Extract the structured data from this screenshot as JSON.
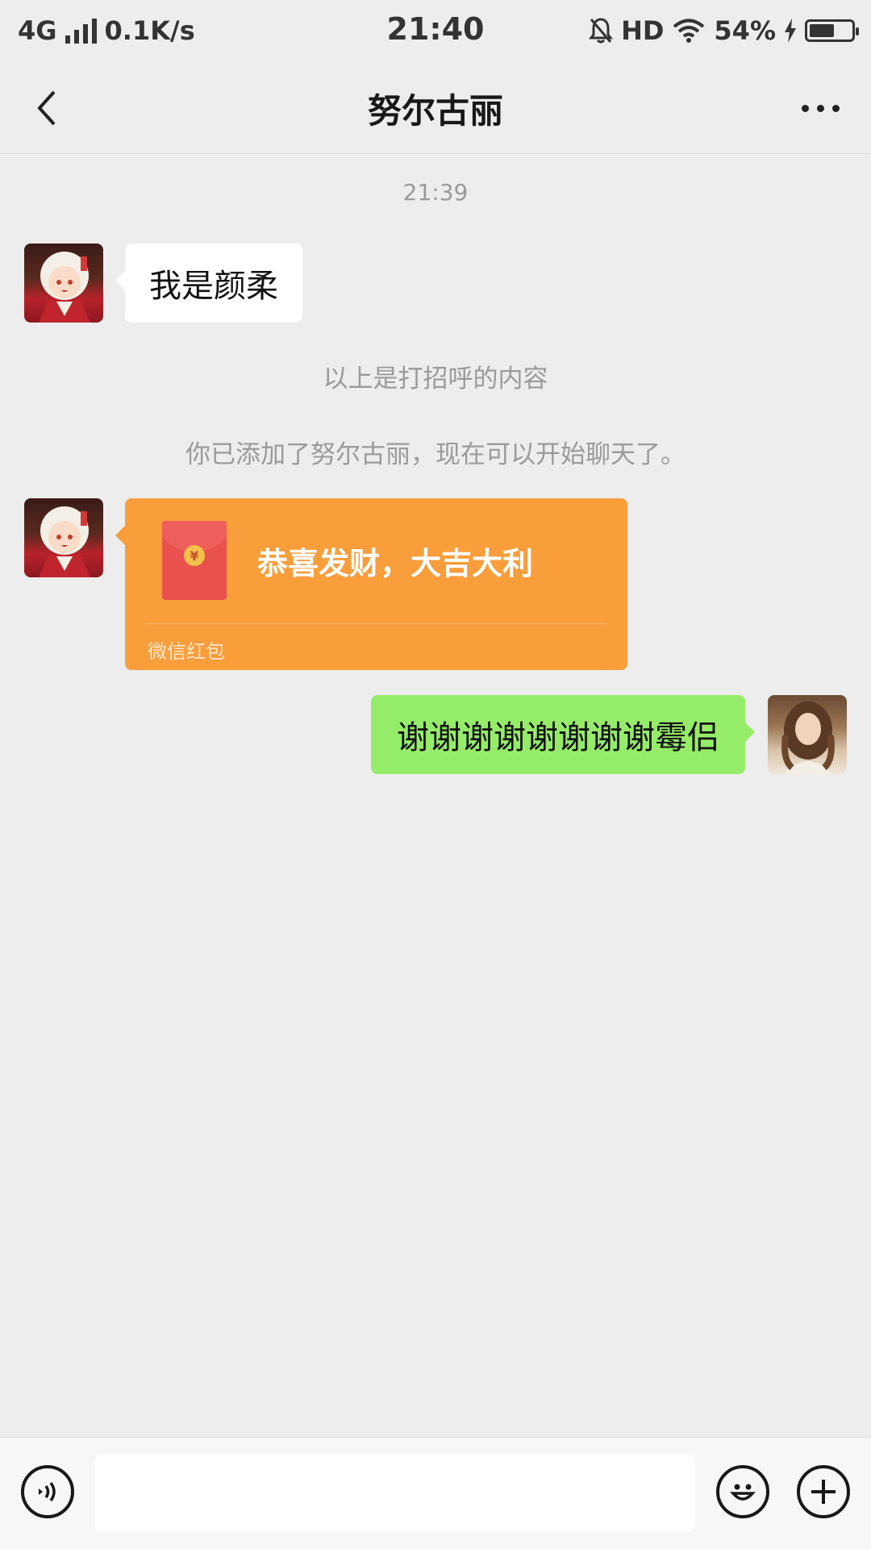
{
  "status_bar": {
    "network": "4G",
    "speed": "0.1K/s",
    "time": "21:40",
    "hd": "HD",
    "battery": "54%"
  },
  "nav": {
    "title": "努尔古丽"
  },
  "chat": {
    "timestamp": "21:39",
    "msg_greeting": "我是颜柔",
    "notice_greeting": "以上是打招呼的内容",
    "notice_added": "你已添加了努尔古丽，现在可以开始聊天了。",
    "red_packet": {
      "title": "恭喜发财，大吉大利",
      "footer": "微信红包",
      "coin": "¥"
    },
    "msg_reply": "谢谢谢谢谢谢谢谢霉侣"
  },
  "input": {
    "value": ""
  },
  "icons": {
    "back": "back-arrow-icon",
    "more": "more-dots-icon",
    "voice": "voice-icon",
    "emoji": "emoji-icon",
    "plus": "plus-icon"
  },
  "colors": {
    "background": "#ededed",
    "green_bubble": "#95ec69",
    "red_packet": "#fa9d3b"
  }
}
